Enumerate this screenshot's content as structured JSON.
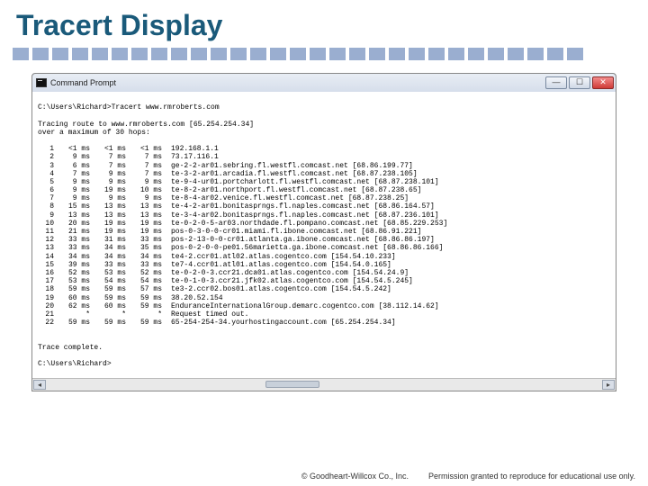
{
  "title": "Tracert Display",
  "window": {
    "title": "Command Prompt",
    "prompt1": "C:\\Users\\Richard>Tracert www.rmroberts.com",
    "trace_intro1": "Tracing route to www.rmroberts.com [65.254.254.34]",
    "trace_intro2": "over a maximum of 30 hops:",
    "hops": [
      {
        "n": "1",
        "t1": "<1 ms",
        "t2": "<1 ms",
        "t3": "<1 ms",
        "host": "192.168.1.1"
      },
      {
        "n": "2",
        "t1": "9 ms",
        "t2": "7 ms",
        "t3": "7 ms",
        "host": "73.17.116.1"
      },
      {
        "n": "3",
        "t1": "6 ms",
        "t2": "7 ms",
        "t3": "7 ms",
        "host": "ge-2-2-ar01.sebring.fl.westfl.comcast.net [68.86.199.77]"
      },
      {
        "n": "4",
        "t1": "7 ms",
        "t2": "9 ms",
        "t3": "7 ms",
        "host": "te-3-2-ar01.arcadia.fl.westfl.comcast.net [68.87.238.105]"
      },
      {
        "n": "5",
        "t1": "9 ms",
        "t2": "9 ms",
        "t3": "9 ms",
        "host": "te-9-4-ur01.portcharlott.fl.westfl.comcast.net [68.87.238.101]"
      },
      {
        "n": "6",
        "t1": "9 ms",
        "t2": "19 ms",
        "t3": "10 ms",
        "host": "te-8-2-ar01.northport.fl.westfl.comcast.net [68.87.238.65]"
      },
      {
        "n": "7",
        "t1": "9 ms",
        "t2": "9 ms",
        "t3": "9 ms",
        "host": "te-8-4-ar02.venice.fl.westfl.comcast.net [68.87.238.25]"
      },
      {
        "n": "8",
        "t1": "15 ms",
        "t2": "13 ms",
        "t3": "13 ms",
        "host": "te-4-2-ar01.bonitasprngs.fl.naples.comcast.net [68.86.164.57]"
      },
      {
        "n": "9",
        "t1": "13 ms",
        "t2": "13 ms",
        "t3": "13 ms",
        "host": "te-3-4-ar02.bonitasprngs.fl.naples.comcast.net [68.87.236.101]"
      },
      {
        "n": "10",
        "t1": "20 ms",
        "t2": "19 ms",
        "t3": "19 ms",
        "host": "te-0-2-0-5-ar03.northdade.fl.pompano.comcast.net [68.85.229.253]"
      },
      {
        "n": "11",
        "t1": "21 ms",
        "t2": "19 ms",
        "t3": "19 ms",
        "host": "pos-0-3-0-0-cr01.miami.fl.ibone.comcast.net [68.86.91.221]"
      },
      {
        "n": "12",
        "t1": "33 ms",
        "t2": "31 ms",
        "t3": "33 ms",
        "host": "pos-2-13-0-0-cr01.atlanta.ga.ibone.comcast.net [68.86.86.197]"
      },
      {
        "n": "13",
        "t1": "33 ms",
        "t2": "34 ms",
        "t3": "35 ms",
        "host": "pos-0-2-0-0-pe01.56marietta.ga.ibone.comcast.net [68.86.86.166]"
      },
      {
        "n": "14",
        "t1": "34 ms",
        "t2": "34 ms",
        "t3": "34 ms",
        "host": "te4-2.ccr01.atl02.atlas.cogentco.com [154.54.10.233]"
      },
      {
        "n": "15",
        "t1": "39 ms",
        "t2": "33 ms",
        "t3": "33 ms",
        "host": "te7-4.ccr01.atl01.atlas.cogentco.com [154.54.0.165]"
      },
      {
        "n": "16",
        "t1": "52 ms",
        "t2": "53 ms",
        "t3": "52 ms",
        "host": "te-0-2-0-3.ccr21.dca01.atlas.cogentco.com [154.54.24.9]"
      },
      {
        "n": "17",
        "t1": "53 ms",
        "t2": "54 ms",
        "t3": "54 ms",
        "host": "te-0-1-0-3.ccr21.jfk02.atlas.cogentco.com [154.54.5.245]"
      },
      {
        "n": "18",
        "t1": "59 ms",
        "t2": "59 ms",
        "t3": "57 ms",
        "host": "te3-2.ccr02.bos01.atlas.cogentco.com [154.54.5.242]"
      },
      {
        "n": "19",
        "t1": "60 ms",
        "t2": "59 ms",
        "t3": "59 ms",
        "host": "38.20.52.154"
      },
      {
        "n": "20",
        "t1": "62 ms",
        "t2": "60 ms",
        "t3": "59 ms",
        "host": "EnduranceInternationalGroup.demarc.cogentco.com [38.112.14.62]"
      },
      {
        "n": "21",
        "t1": "*",
        "t2": "*",
        "t3": "*",
        "host": "Request timed out."
      },
      {
        "n": "22",
        "t1": "59 ms",
        "t2": "59 ms",
        "t3": "59 ms",
        "host": "65-254-254-34.yourhostingaccount.com [65.254.254.34]"
      }
    ],
    "trace_complete": "Trace complete.",
    "prompt2": "C:\\Users\\Richard>"
  },
  "footer": {
    "copyright": "© Goodheart-Willcox Co., Inc.",
    "permission": "Permission granted to reproduce for educational use only."
  }
}
